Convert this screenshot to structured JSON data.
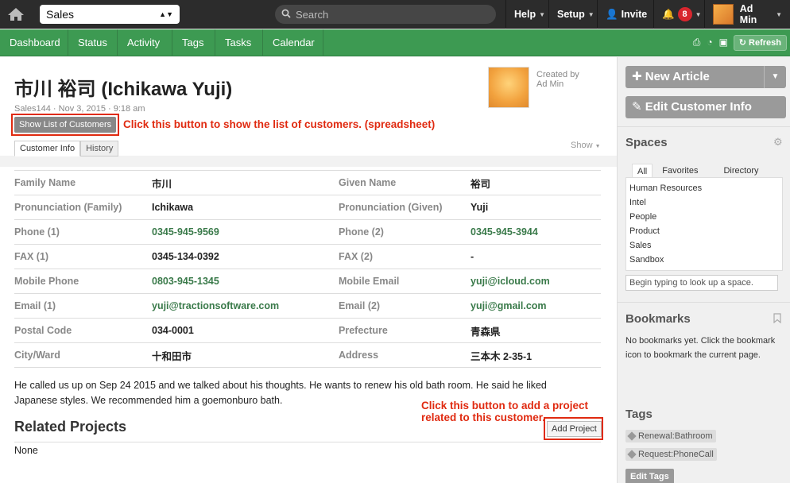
{
  "topbar": {
    "space": "Sales",
    "search_placeholder": "Search",
    "nav": [
      "Help",
      "Setup",
      "Invite"
    ],
    "notifications": "8",
    "user": "Ad Min"
  },
  "greenbar": {
    "tabs": [
      "Dashboard",
      "Status",
      "Activity",
      "Tags",
      "Tasks",
      "Calendar"
    ],
    "refresh": "Refresh"
  },
  "article": {
    "title": "市川 裕司 (Ichikawa Yuji)",
    "meta": "Sales144 · Nov 3, 2015 · 9:18 am",
    "created_by": "Created by",
    "author": "Ad Min",
    "show_list_button": "Show List of Customers",
    "annotation1": "Click this button to show the list of customers. (spreadsheet)",
    "tabs": [
      "Customer Info",
      "History"
    ],
    "show": "Show",
    "fields": [
      {
        "l1": "Family Name",
        "v1": "市川",
        "l2": "Given Name",
        "v2": "裕司"
      },
      {
        "l1": "Pronunciation (Family)",
        "v1": "Ichikawa",
        "l2": "Pronunciation (Given)",
        "v2": "Yuji"
      },
      {
        "l1": "Phone (1)",
        "v1": "0345-945-9569",
        "l2": "Phone (2)",
        "v2": "0345-945-3944"
      },
      {
        "l1": "FAX (1)",
        "v1": "0345-134-0392",
        "l2": "FAX (2)",
        "v2": "-"
      },
      {
        "l1": "Mobile Phone",
        "v1": "0803-945-1345",
        "l2": "Mobile Email",
        "v2": "yuji@icloud.com"
      },
      {
        "l1": "Email (1)",
        "v1": "yuji@tractionsoftware.com",
        "l2": "Email (2)",
        "v2": "yuji@gmail.com"
      },
      {
        "l1": "Postal Code",
        "v1": "034-0001",
        "l2": "Prefecture",
        "v2": "青森県"
      },
      {
        "l1": "City/Ward",
        "v1": "十和田市",
        "l2": "Address",
        "v2": "三本木 2-35-1"
      }
    ],
    "note_line1": "He called us up on Sep 24 2015 and we talked about his thoughts. He wants to renew his old bath room. He said he liked",
    "note_line2": "Japanese styles. We recommended him a goemonburo bath.",
    "related_title": "Related Projects",
    "add_project": "Add Project",
    "annotation2": "Click this button to add a project related to this customer.",
    "related_none": "None"
  },
  "sidebar": {
    "new_article": "New Article",
    "edit_info": "Edit Customer Info",
    "spaces_title": "Spaces",
    "spaces_tabs": [
      "All",
      "Favorites",
      "Directory"
    ],
    "spaces": [
      "Human Resources",
      "Intel",
      "People",
      "Product",
      "Sales",
      "Sandbox"
    ],
    "space_lookup": "Begin typing to look up a space.",
    "bookmarks_title": "Bookmarks",
    "bookmarks_text": "No bookmarks yet. Click the bookmark icon to bookmark the current page.",
    "tags_title": "Tags",
    "tags": [
      "Renewal:Bathroom",
      "Request:PhoneCall"
    ],
    "edit_tags": "Edit Tags"
  }
}
